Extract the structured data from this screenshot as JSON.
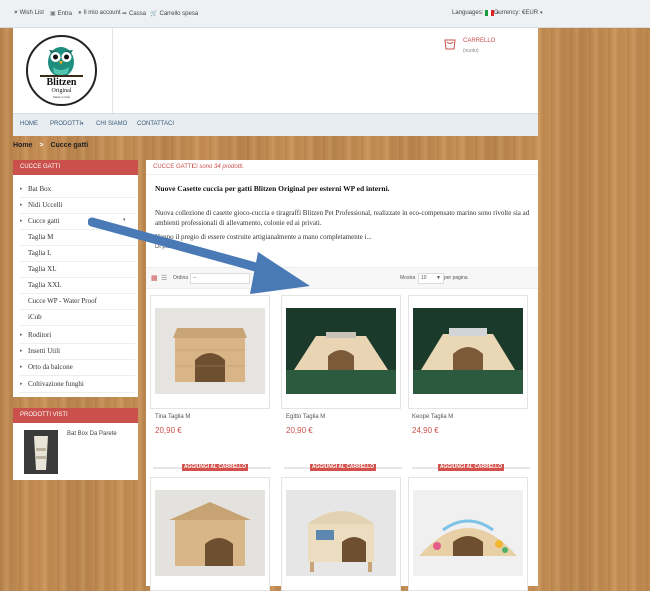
{
  "topbar": {
    "wishlist": "Wish List",
    "login": "Entra",
    "account": "Il mio account",
    "checkout": "Cassa",
    "cart": "Carrello spesa",
    "languages_label": "Languages:",
    "currency_label": "Currency:",
    "currency_value": "€EUR"
  },
  "header": {
    "logo_text": "Blitzen",
    "logo_sub": "Original",
    "logo_tag": "Made in Italy",
    "cart_title": "CARRELLO",
    "cart_status": "(vuoto)"
  },
  "nav": {
    "home": "HOME",
    "products": "PRODOTTI",
    "about": "CHI SIAMO",
    "contacts": "CONTATTACI"
  },
  "breadcrumb": {
    "home": "Home",
    "sep": ">",
    "current": "Cucce gatti"
  },
  "sidebar": {
    "title": "CUCCE GATTI",
    "items": [
      "Bat Box",
      "Nidi Uccelli",
      "Cucce gatti",
      "Taglia M",
      "Taglia L",
      "Taglia XL",
      "Taglia XXL",
      "Cucce WP - Water Proof",
      "iCub",
      "Roditori",
      "Insetti Utili",
      "Orto da balcone",
      "Coltivazione funghi"
    ],
    "viewed_title": "PRODOTTI VISTI",
    "viewed_item": "Bat Box Da Parete"
  },
  "main": {
    "category": "CUCCE GATTI",
    "count": "Ci sono 34 prodotti.",
    "heading": "Nuove Casette cuccia per gatti Blitzen Original per esterni WP ed interni.",
    "para1": "Nuova collezione di casette gioco-cuccia e tiragraffi Blitzen Pet Professional, realizzate in eco-compensato marino sono rivolte sia ad ambienti professionali di allevamento, colonie ed ai privati.",
    "para2": "Hanno il pregio di essere costruite artigianalmente a mano completamente i...",
    "more": "Di più",
    "sort_label": "Ordina",
    "sort_value": "--",
    "show_label": "Mostra",
    "show_value": "10",
    "per_page": "per pagina",
    "add_label": "AGGIUNGI AL CARRELLO"
  },
  "products": [
    {
      "name": "Tina Taglia M",
      "price": "20,90 €"
    },
    {
      "name": "Egitto Taglia M",
      "price": "20,90 €"
    },
    {
      "name": "Keope Taglia M",
      "price": "24,90 €"
    }
  ],
  "colors": {
    "accent": "#c9504b",
    "arrow": "#4a7ab5"
  }
}
